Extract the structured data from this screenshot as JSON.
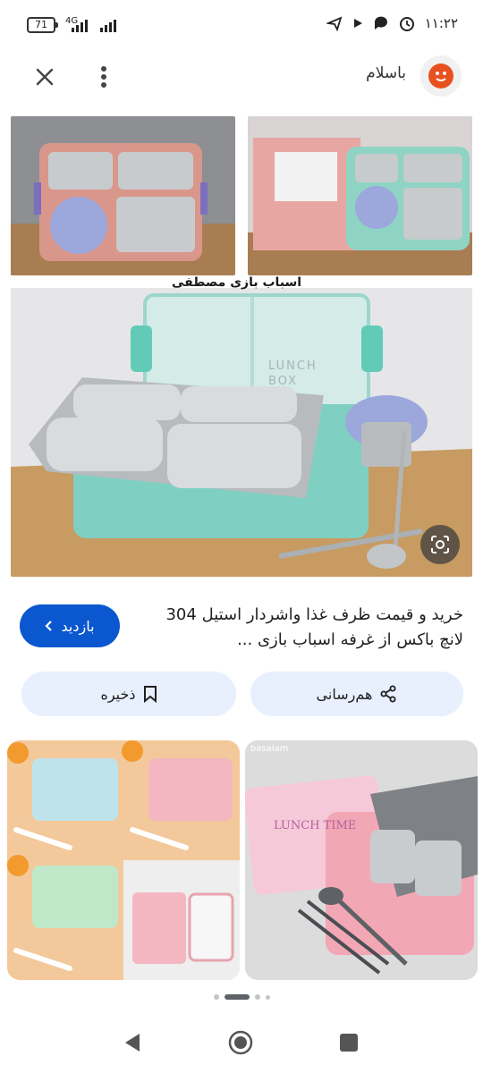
{
  "status_bar": {
    "battery": "71",
    "network": "4G",
    "time": "۱۱:۲۲"
  },
  "header": {
    "site_name": "باسلام",
    "close_icon": "close-icon",
    "more_icon": "more-vert-icon"
  },
  "image": {
    "watermark": "اسباب بازی مصطفی",
    "box_label_1": "LUNCH",
    "box_label_2": "BOX",
    "lens_icon": "google-lens-icon"
  },
  "result": {
    "title": "خرید و قیمت ظرف غذا واشردار استیل 304 لانچ باکس از غرفه اسباب بازی ...",
    "visit_label": "بازدید",
    "visit_icon": "chevron-left-icon"
  },
  "actions": {
    "share_label": "هم‌رسانی",
    "save_label": "ذخیره"
  },
  "related": {
    "right_caption": "LUNCH TIME",
    "watermark_small": "basalam"
  },
  "colors": {
    "accent": "#0b57d0",
    "chip_bg": "#e8f0fe",
    "logo": "#e8501e"
  }
}
